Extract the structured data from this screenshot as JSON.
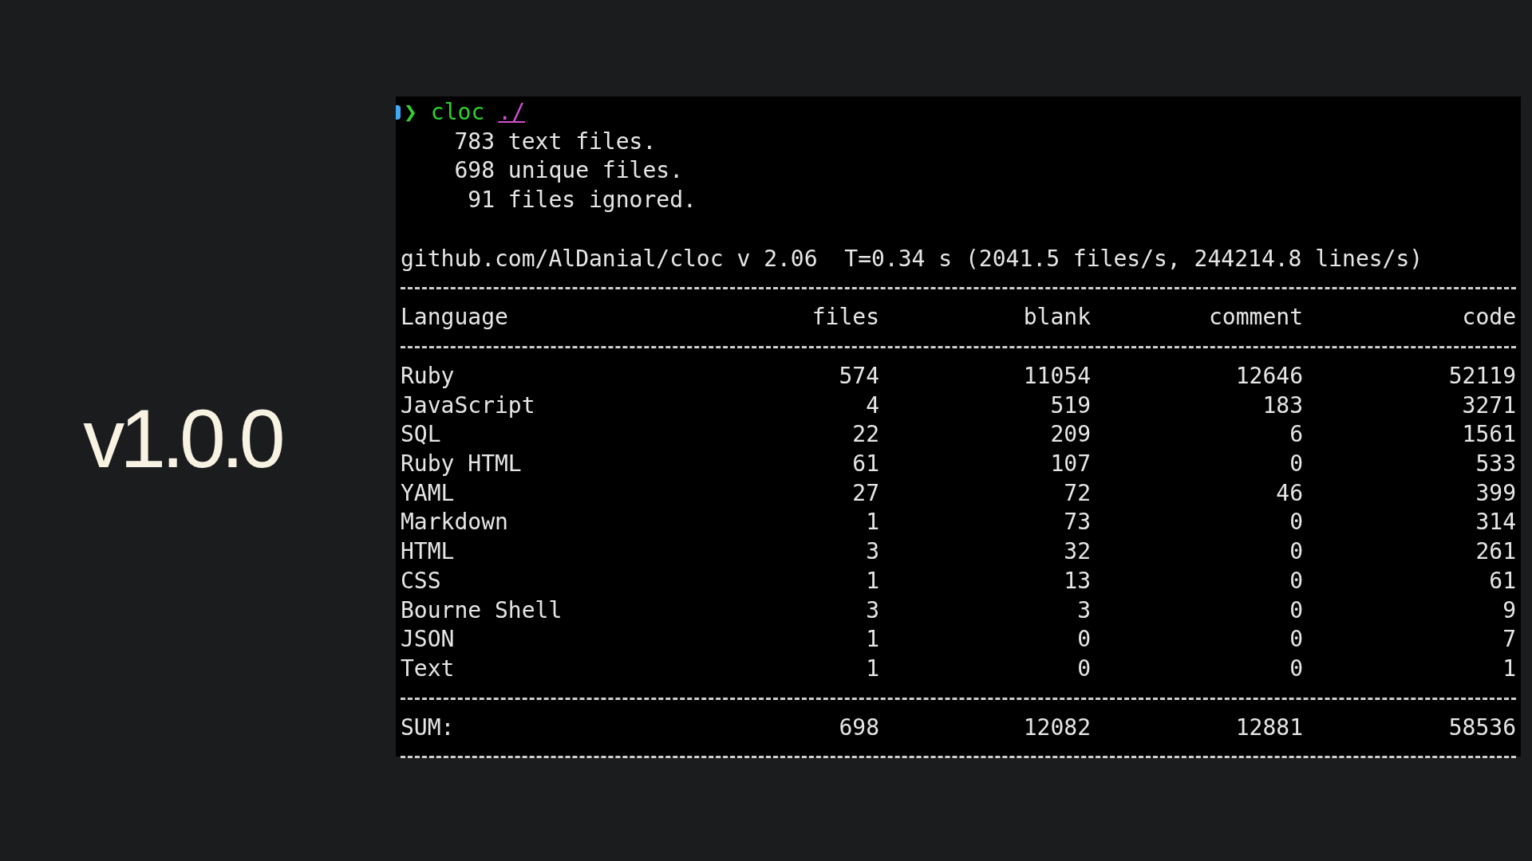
{
  "version_label": "v1.0.0",
  "terminal": {
    "prompt": {
      "symbol": "❯",
      "command": "cloc",
      "argument": "./"
    },
    "summary_lines": [
      "    783 text files.",
      "    698 unique files.",
      "     91 files ignored."
    ],
    "header_line": "github.com/AlDanial/cloc v 2.06  T=0.34 s (2041.5 files/s, 244214.8 lines/s)",
    "table": {
      "columns": [
        "Language",
        "files",
        "blank",
        "comment",
        "code"
      ],
      "rows": [
        [
          "Ruby",
          "574",
          "11054",
          "12646",
          "52119"
        ],
        [
          "JavaScript",
          "4",
          "519",
          "183",
          "3271"
        ],
        [
          "SQL",
          "22",
          "209",
          "6",
          "1561"
        ],
        [
          "Ruby HTML",
          "61",
          "107",
          "0",
          "533"
        ],
        [
          "YAML",
          "27",
          "72",
          "46",
          "399"
        ],
        [
          "Markdown",
          "1",
          "73",
          "0",
          "314"
        ],
        [
          "HTML",
          "3",
          "32",
          "0",
          "261"
        ],
        [
          "CSS",
          "1",
          "13",
          "0",
          "61"
        ],
        [
          "Bourne Shell",
          "3",
          "3",
          "0",
          "9"
        ],
        [
          "JSON",
          "1",
          "0",
          "0",
          "7"
        ],
        [
          "Text",
          "1",
          "0",
          "0",
          "1"
        ]
      ],
      "sum": [
        "SUM:",
        "698",
        "12082",
        "12881",
        "58536"
      ]
    }
  }
}
